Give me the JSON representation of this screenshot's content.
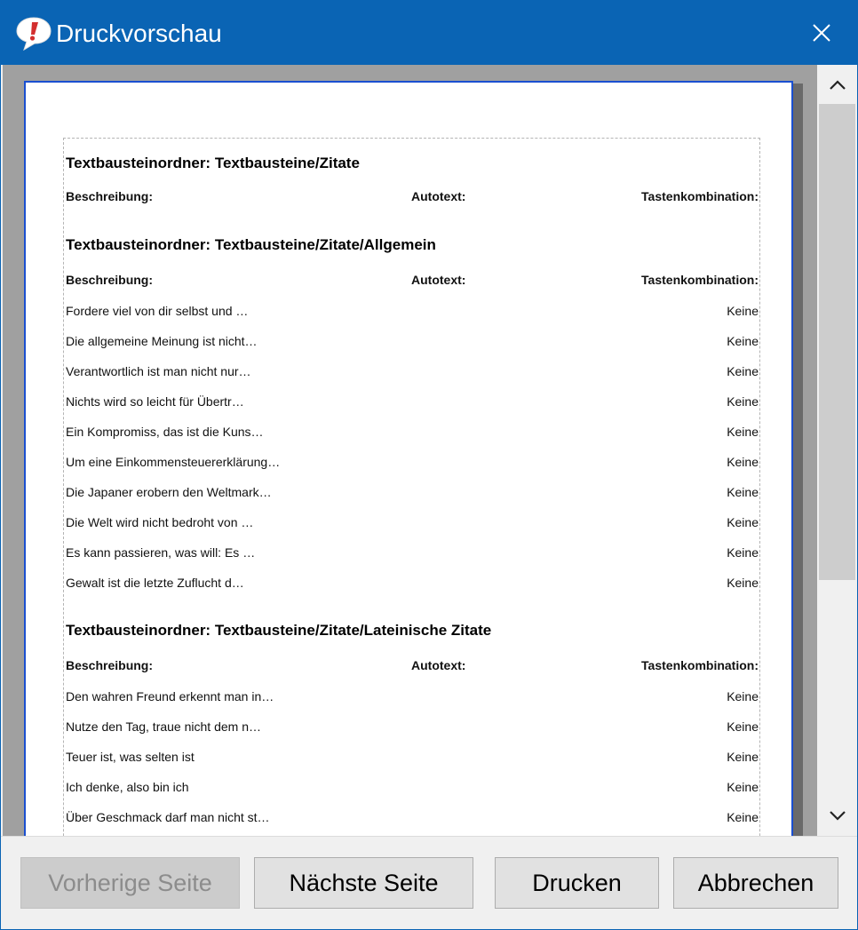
{
  "window": {
    "title": "Druckvorschau"
  },
  "icons": {
    "app": "speech-bubble-exclamation-icon",
    "close": "close-icon",
    "scroll_up": "chevron-up-icon",
    "scroll_down": "chevron-down-icon"
  },
  "colors": {
    "titlebar": "#0a64b4",
    "page_border": "#1a4fd0",
    "app_icon_mark": "#d32f2f"
  },
  "document": {
    "sections": [
      {
        "title": "Textbausteinordner: Textbausteine/Zitate",
        "headers": [
          "Beschreibung:",
          "Autotext:",
          "Tastenkombination:"
        ],
        "rows": []
      },
      {
        "title": "Textbausteinordner: Textbausteine/Zitate/Allgemein",
        "headers": [
          "Beschreibung:",
          "Autotext:",
          "Tastenkombination:"
        ],
        "rows": [
          {
            "beschreibung": "Fordere viel von dir selbst und …",
            "tastenkombination": "Keine"
          },
          {
            "beschreibung": "Die allgemeine Meinung ist nicht…",
            "tastenkombination": "Keine"
          },
          {
            "beschreibung": "Verantwortlich ist man nicht nur…",
            "tastenkombination": "Keine"
          },
          {
            "beschreibung": "Nichts wird so leicht für Übertr…",
            "tastenkombination": "Keine"
          },
          {
            "beschreibung": "Ein Kompromiss, das ist die Kuns…",
            "tastenkombination": "Keine"
          },
          {
            "beschreibung": "Um eine Einkommensteuererklärung…",
            "tastenkombination": "Keine"
          },
          {
            "beschreibung": "Die Japaner erobern den Weltmark…",
            "tastenkombination": "Keine"
          },
          {
            "beschreibung": "Die Welt wird nicht bedroht von …",
            "tastenkombination": "Keine"
          },
          {
            "beschreibung": "Es kann passieren, was will: Es …",
            "tastenkombination": "Keine"
          },
          {
            "beschreibung": "Gewalt ist die letzte Zuflucht d…",
            "tastenkombination": "Keine"
          }
        ]
      },
      {
        "title": "Textbausteinordner: Textbausteine/Zitate/Lateinische Zitate",
        "headers": [
          "Beschreibung:",
          "Autotext:",
          "Tastenkombination:"
        ],
        "rows": [
          {
            "beschreibung": "Den wahren Freund erkennt man in…",
            "tastenkombination": "Keine"
          },
          {
            "beschreibung": "Nutze den Tag, traue nicht dem n…",
            "tastenkombination": "Keine"
          },
          {
            "beschreibung": "Teuer ist, was selten ist",
            "tastenkombination": "Keine"
          },
          {
            "beschreibung": "Ich denke, also bin ich",
            "tastenkombination": "Keine"
          },
          {
            "beschreibung": "Über Geschmack darf man nicht st…",
            "tastenkombination": "Keine"
          }
        ]
      }
    ]
  },
  "buttons": {
    "previous": {
      "label": "Vorherige Seite",
      "enabled": false
    },
    "next": {
      "label": "Nächste Seite",
      "enabled": true
    },
    "print": {
      "label": "Drucken",
      "enabled": true
    },
    "cancel": {
      "label": "Abbrechen",
      "enabled": true
    }
  }
}
